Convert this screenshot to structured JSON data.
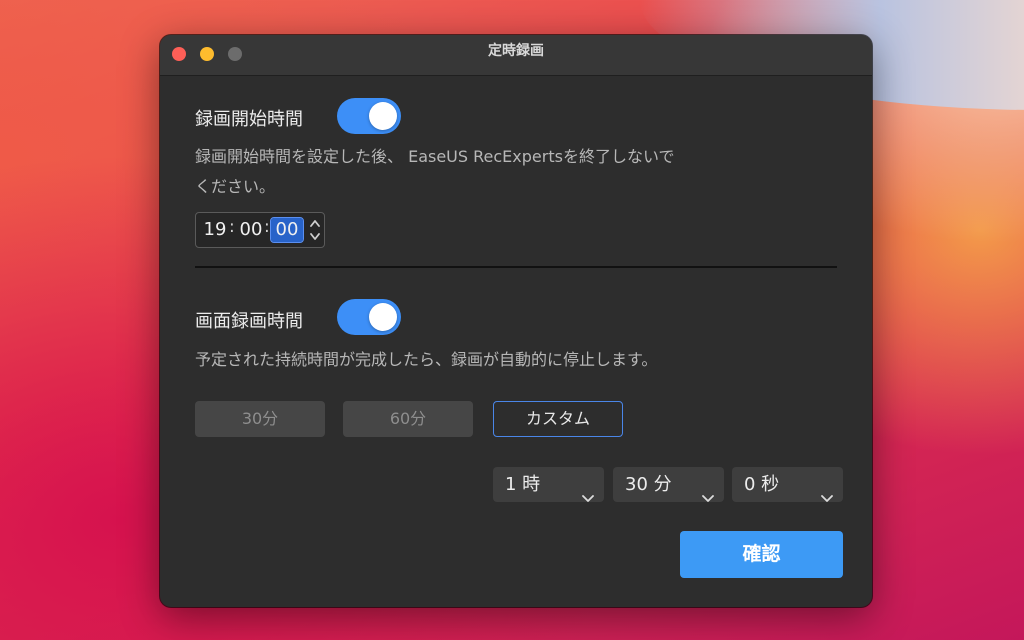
{
  "window": {
    "title": "定時録画"
  },
  "start_section": {
    "title": "録画開始時間",
    "toggle_on": true,
    "description_line1": "録画開始時間を設定した後、 EaseUS RecExpertsを終了しないで",
    "description_line2": "ください。",
    "time": {
      "hours": "19",
      "minutes": "00",
      "seconds": "00",
      "separator": ":"
    }
  },
  "duration_section": {
    "title": "画面録画時間",
    "toggle_on": true,
    "description": "予定された持続時間が完成したら、録画が自動的に停止します。",
    "options": [
      "30分",
      "60分",
      "カスタム"
    ],
    "selected_option": "カスタム",
    "custom": {
      "hours": "1 時",
      "minutes": "30 分",
      "seconds": "0 秒"
    }
  },
  "confirm_label": "確認",
  "colors": {
    "accent": "#3d8ff7",
    "button": "#3d9af5",
    "window_bg": "#2d2d2d",
    "close": "#fe5f57",
    "minimize": "#febc2e",
    "maximize_disabled": "#6c6c6c"
  }
}
